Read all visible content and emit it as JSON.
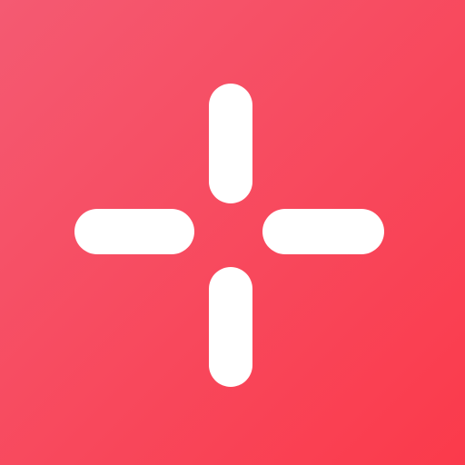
{
  "icon": {
    "name": "crosshair-icon",
    "background_start": "#f45a72",
    "background_end": "#fb3a4b",
    "mark_color": "#ffffff"
  }
}
